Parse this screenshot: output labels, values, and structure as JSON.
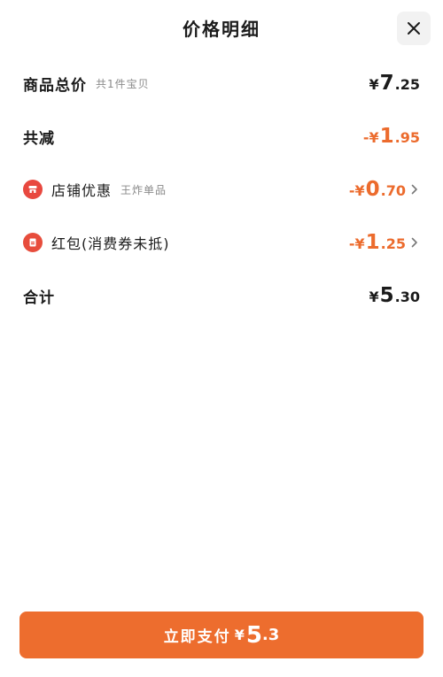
{
  "header": {
    "title": "价格明细",
    "close_icon": "close-icon"
  },
  "rows": {
    "subtotal": {
      "label": "商品总价",
      "note": "共1件宝贝",
      "currency": "¥",
      "int": "7",
      "dec": ".25"
    },
    "discount": {
      "label": "共减",
      "sign": "-",
      "currency": "¥",
      "int": "1",
      "dec": ".95"
    },
    "shop": {
      "label": "店铺优惠",
      "note": "王炸单品",
      "sign": "-",
      "currency": "¥",
      "int": "0",
      "dec": ".70",
      "icon": "shop-badge-icon"
    },
    "redpacket": {
      "label": "红包(消费券未抵)",
      "sign": "-",
      "currency": "¥",
      "int": "1",
      "dec": ".25",
      "icon": "red-packet-icon"
    },
    "total": {
      "label": "合计",
      "currency": "¥",
      "int": "5",
      "dec": ".30"
    }
  },
  "pay_button": {
    "label": "立即支付",
    "currency": "¥",
    "int": "5",
    "dec": ".3"
  },
  "colors": {
    "accent": "#ed6d2e",
    "badge_red": "#e8483f",
    "muted": "#8a8a8a"
  }
}
